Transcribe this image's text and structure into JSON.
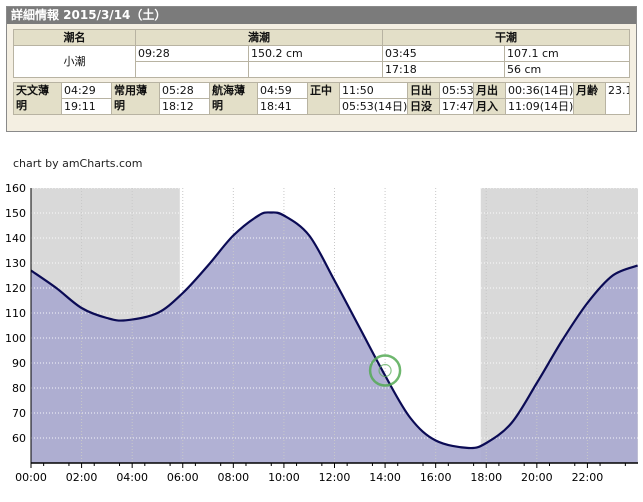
{
  "panel": {
    "title": "詳細情報 2015/3/14（土）",
    "headers": {
      "name": "潮名",
      "high": "満潮",
      "low": "干潮"
    },
    "tide_name": "小潮",
    "high_tides": [
      {
        "time": "09:28",
        "level": "150.2 cm"
      },
      {
        "time": "",
        "level": ""
      }
    ],
    "low_tides": [
      {
        "time": "03:45",
        "level": "107.1 cm"
      },
      {
        "time": "17:18",
        "level": "56 cm"
      }
    ]
  },
  "sun": {
    "astro_label": "天文薄明",
    "astro_am": "04:29",
    "astro_pm": "19:11",
    "civil_label": "常用薄明",
    "civil_am": "05:28",
    "civil_pm": "18:12",
    "naut_label": "航海薄明",
    "naut_am": "04:59",
    "naut_pm": "18:41",
    "transit_label": "正中",
    "transit_sun": "11:50",
    "transit_moon": "05:53(14日)",
    "sunrise_label": "日出",
    "sunrise": "05:53",
    "sunset_label": "日没",
    "sunset": "17:47",
    "moonrise_label": "月出",
    "moonrise": "00:36(14日)",
    "moonset_label": "月入",
    "moonset": "11:09(14日)",
    "moonage_label": "月齢",
    "moonage": "23.1"
  },
  "chart": {
    "credit": "chart by amCharts.com"
  },
  "chart_data": {
    "type": "area",
    "xlabel": "",
    "ylabel": "",
    "ylim": [
      50,
      160
    ],
    "xlim": [
      "00:00",
      "24:00"
    ],
    "y_ticks": [
      60,
      70,
      80,
      90,
      100,
      110,
      120,
      130,
      140,
      150,
      160
    ],
    "x_ticks": [
      "00:00",
      "02:00",
      "04:00",
      "06:00",
      "08:00",
      "10:00",
      "12:00",
      "14:00",
      "16:00",
      "18:00",
      "20:00",
      "22:00"
    ],
    "series": [
      {
        "x": [
          "00:00",
          "01:00",
          "02:00",
          "03:00",
          "03:45",
          "05:00",
          "06:00",
          "07:00",
          "08:00",
          "09:00",
          "09:28",
          "10:00",
          "11:00",
          "12:00",
          "13:00",
          "14:00",
          "15:00",
          "16:00",
          "17:18",
          "18:00",
          "19:00",
          "20:00",
          "21:00",
          "22:00",
          "23:00",
          "23:59"
        ],
        "values": [
          127,
          120,
          112,
          108,
          107.1,
          110,
          118,
          129,
          141,
          149,
          150.2,
          149,
          141,
          123,
          104,
          85,
          68,
          59,
          56,
          58,
          66,
          82,
          99,
          114,
          125,
          129
        ]
      }
    ],
    "night_before": "05:53",
    "night_after": "17:47",
    "cursor": {
      "time": "14:00",
      "value": 87
    },
    "colors": {
      "line": "#0b0b55",
      "fill": "#a9a9cf",
      "night": "#d9d9d9",
      "cursor": "#55aa55"
    },
    "grid": true
  }
}
